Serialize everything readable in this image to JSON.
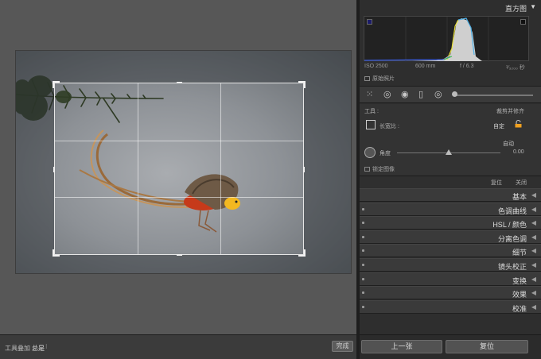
{
  "histogram": {
    "title": "直方图",
    "iso": "ISO 2500",
    "focal_length": "600 mm",
    "aperture": "f / 6.3",
    "shutter": "¹⁄₃₂₀₀ 秒",
    "original_photo_label": "原始照片"
  },
  "crop_tool": {
    "tool_label": "工具 :",
    "tool_name": "裁剪并修齐",
    "aspect_label": "长宽比 :",
    "aspect_value": "自定",
    "auto_label": "自动",
    "angle_label": "角度",
    "angle_value": "0.00",
    "angle_fraction": 0.5,
    "lock_image_label": "锁定图像",
    "reset_label": "复位",
    "close_label": "关闭"
  },
  "sections": [
    {
      "label": "基本"
    },
    {
      "label": "色调曲线"
    },
    {
      "label": "HSL / 颜色"
    },
    {
      "label": "分离色调"
    },
    {
      "label": "细节"
    },
    {
      "label": "镜头校正"
    },
    {
      "label": "变换"
    },
    {
      "label": "效果"
    },
    {
      "label": "校准"
    }
  ],
  "bottom_bar": {
    "previous_label": "上一张",
    "reset_label": "复位"
  },
  "toolbar": {
    "overlay_label": "工具叠加 :",
    "overlay_value": "总是",
    "done_label": "完成"
  },
  "colors": {
    "accent": "#f0a020",
    "panel_bg": "#2e2e2e",
    "canvas_bg": "#575757"
  }
}
